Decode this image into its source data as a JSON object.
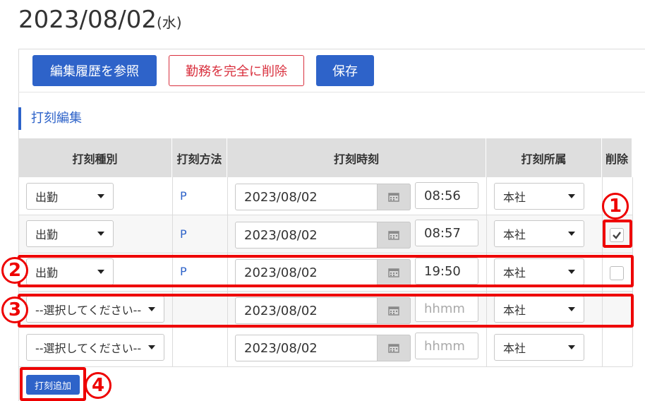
{
  "header": {
    "date": "2023/08/02",
    "weekday": "(水)"
  },
  "toolbar": {
    "history_label": "編集履歴を参照",
    "delete_label": "勤務を完全に削除",
    "save_label": "保存"
  },
  "section": {
    "title": "打刻編集"
  },
  "table": {
    "columns": [
      "打刻種別",
      "打刻方法",
      "打刻時刻",
      "打刻所属",
      "削除"
    ],
    "rows": [
      {
        "type": "出勤",
        "method": "P",
        "date": "2023/08/02",
        "time": "08:56",
        "affiliation": "本社",
        "checked": false
      },
      {
        "type": "出勤",
        "method": "P",
        "date": "2023/08/02",
        "time": "08:57",
        "affiliation": "本社",
        "checked": true
      },
      {
        "type": "出勤",
        "method": "P",
        "date": "2023/08/02",
        "time": "19:50",
        "affiliation": "本社",
        "checked": false
      },
      {
        "type": "--選択してください--",
        "method": "",
        "date": "2023/08/02",
        "time_placeholder": "hhmm",
        "affiliation": "本社",
        "checked": null
      },
      {
        "type": "--選択してください--",
        "method": "",
        "date": "2023/08/02",
        "time_placeholder": "hhmm",
        "affiliation": "本社",
        "checked": null
      }
    ]
  },
  "add_button": {
    "label": "打刻追加"
  },
  "annotations": {
    "one": "1",
    "two": "2",
    "three": "3",
    "four": "4"
  },
  "colors": {
    "accent": "#2e63c9",
    "danger": "#d9303e",
    "annotation": "#ee0000"
  }
}
